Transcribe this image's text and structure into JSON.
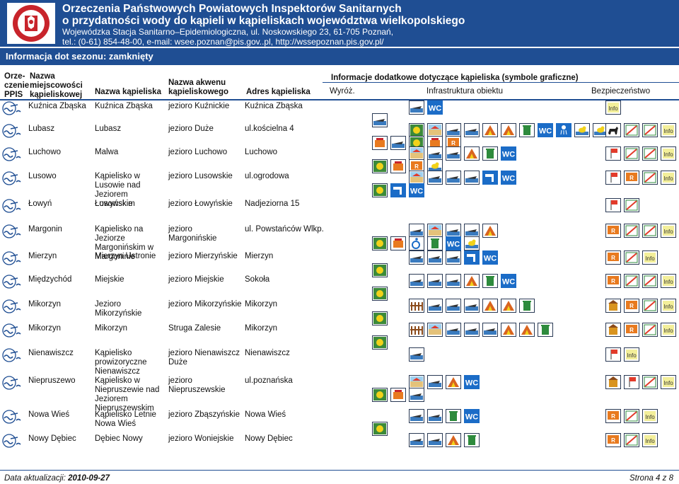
{
  "header": {
    "line1": "Orzeczenia Państwowych Powiatowych Inspektorów Sanitarnych",
    "line2": "o przydatności wody do kąpieli w kąpieliskach województwa wielkopolskiego",
    "line3": "Wojewódzka Stacja Sanitarno–Epidemiologiczna, ul. Noskowskiego 23, 61-705 Poznań,",
    "line4": "tel.: (0-61) 854-48-00, e-mail: wsee.poznan@pis.gov..pl, http://wssepoznan.pis.gov.pl/",
    "logo_text": "PAŃSTWOWA INSPEKCJA SANITARNA"
  },
  "season": "Informacja dot sezonu:   zamknięty",
  "columns": {
    "orzeczenie": "Orze-\nczenie\nPPIS",
    "miejscowosc": "Nazwa\nmiejscowości\nkąpieliskowej",
    "kapielisko": "Nazwa kąpieliska",
    "akwen": "Nazwa akwenu\nkąpieliskowego",
    "adres": "Adres kąpieliska",
    "info": "Informacje dodatkowe dotyczące kąpieliska (symbole graficzne)",
    "wyroz": "Wyróż.",
    "infra": "Infrastruktura obiektu",
    "bezp": "Bezpieczeństwo"
  },
  "rows": [
    {
      "miejscowosc": "Kuźnica Zbąska",
      "kapielisko": "Kuźnica Zbąska",
      "akwen": "jezioro Kuźnickie",
      "adres": "Kuźnica Zbąska",
      "infra": [
        "boat-icon",
        "wc-icon"
      ],
      "infra2": [
        "boat-icon"
      ],
      "bezp": [
        "info-icon"
      ]
    },
    {
      "miejscowosc": "Lubasz",
      "kapielisko": "Lubasz",
      "akwen": "jezioro Duże",
      "adres": "ul.kościelna 4",
      "infra": [
        "volleyball-icon",
        "beach-icon",
        "boat-icon",
        "kayak-icon",
        "tent-icon",
        "campfire-icon",
        "bin-icon",
        "wc-icon",
        "shower-icon",
        "playground-icon",
        "duck-icon"
      ],
      "infra2": [
        "grill-icon",
        "pier-icon",
        "sun-icon",
        "food-icon",
        "rescue-icon"
      ],
      "bezp": [
        "dog-icon",
        "no-smoking-icon",
        "no-alcohol-icon",
        "info-icon"
      ]
    },
    {
      "miejscowosc": "Luchowo",
      "kapielisko": "Malwa",
      "akwen": "jezioro Luchowo",
      "adres": "Luchowo",
      "infra": [
        "beach-icon",
        "boat-icon",
        "kayak-icon",
        "tent-icon",
        "bin-icon",
        "wc-icon"
      ],
      "infra2": [
        "sun-icon",
        "food-icon",
        "rescue-icon",
        "playground-icon"
      ],
      "bezp": [
        "flag-icon",
        "no-smoking-icon",
        "no-alcohol-icon",
        "info-icon"
      ]
    },
    {
      "miejscowosc": "Lusowo",
      "kapielisko": "Kąpielisko w Lusowie nad Jeziorem Lusowskim",
      "akwen": "jezioro Lusowskie",
      "adres": "ul.ogrodowa",
      "infra": [
        "beach-icon",
        "boat-icon",
        "kayak-icon",
        "pier-icon",
        "tap-icon",
        "wc-icon"
      ],
      "infra2": [
        "sun-icon",
        "tap-icon",
        "wc-icon"
      ],
      "bezp": [
        "flag-icon",
        "rescue-icon",
        "no-alcohol-icon",
        "info-icon"
      ]
    },
    {
      "miejscowosc": "Łowyń",
      "kapielisko": "Łowyńskie",
      "akwen": "jezioro Łowyńskie",
      "adres": "Nadjeziorna 15",
      "infra": [],
      "infra2": [],
      "bezp": [
        "flag-icon",
        "no-alcohol-icon"
      ]
    },
    {
      "miejscowosc": "Margonin",
      "kapielisko": "Kąpielisko na Jeziorze Margonińskim w Margoninie",
      "akwen": "jezioro Margonińskie",
      "adres": "ul. Powstańców Wlkp.",
      "infra": [
        "boat-icon",
        "beach-icon",
        "kayak-icon",
        "pier-icon",
        "tent-icon"
      ],
      "infra2": [
        "sun-icon",
        "food-icon",
        "disabled-icon",
        "bin-icon",
        "wc-icon",
        "duck-icon"
      ],
      "bezp": [
        "rescue-icon",
        "no-smoking-icon",
        "no-alcohol-icon",
        "info-icon"
      ]
    },
    {
      "miejscowosc": "Mierzyn",
      "kapielisko": "Mierzyn Ustronie",
      "akwen": "jezioro Mierzyńskie",
      "adres": "Mierzyn",
      "infra": [
        "boat-icon",
        "pier-icon",
        "kayak-icon",
        "tap-icon",
        "wc-icon"
      ],
      "infra2": [
        "sun-icon"
      ],
      "bezp": [
        "rescue-icon",
        "no-alcohol-icon",
        "info-icon"
      ]
    },
    {
      "miejscowosc": "Międzychód",
      "kapielisko": "Miejskie",
      "akwen": "jezioro Miejskie",
      "adres": "Sokoła",
      "infra": [
        "boat-icon",
        "kayak-icon",
        "pier-icon",
        "tent-icon",
        "bin-icon",
        "wc-icon"
      ],
      "infra2": [
        "sun-icon"
      ],
      "bezp": [
        "rescue-icon",
        "no-smoking-icon",
        "no-alcohol-icon",
        "info-icon"
      ]
    },
    {
      "miejscowosc": "Mikorzyn",
      "kapielisko": "Jezioro Mikorzyńskie",
      "akwen": "jezioro Mikorzyńskie",
      "adres": "Mikorzyn",
      "infra": [
        "fence-icon",
        "boat-icon",
        "kayak-icon",
        "pier-icon",
        "tent-icon",
        "campfire-icon",
        "bin-icon"
      ],
      "infra2": [
        "sun-icon"
      ],
      "bezp": [
        "cabin-icon",
        "rescue-icon",
        "no-alcohol-icon",
        "info-icon"
      ]
    },
    {
      "miejscowosc": "Mikorzyn",
      "kapielisko": "Mikorzyn",
      "akwen": "Struga Zalesie",
      "adres": "Mikorzyn",
      "infra": [
        "fence-icon",
        "beach-icon",
        "boat-icon",
        "kayak-icon",
        "pier-icon",
        "tent-icon",
        "campfire-icon",
        "bin-icon"
      ],
      "infra2": [
        "sun-icon"
      ],
      "bezp": [
        "cabin-icon",
        "rescue-icon",
        "no-alcohol-icon",
        "info-icon"
      ]
    },
    {
      "miejscowosc": "Nienawiszcz",
      "kapielisko": "Kąpielisko prowizoryczne Nienawiszcz",
      "akwen": "jezioro Nienawiszcz Duże",
      "adres": "Nienawiszcz",
      "infra": [
        "boat-icon"
      ],
      "infra2": [],
      "bezp": [
        "flag-icon",
        "info-icon"
      ]
    },
    {
      "miejscowosc": "Niepruszewo",
      "kapielisko": "Kąpielisko w Niepruszewie nad Jeziorem Niepruszewskim",
      "akwen": "jezioro Niepruszewskie",
      "adres": "ul.poznańska",
      "infra": [
        "beach-icon",
        "boat-icon",
        "tent-icon",
        "wc-icon"
      ],
      "infra2": [
        "sun-icon",
        "food-icon",
        "pier-icon"
      ],
      "bezp": [
        "cabin-icon",
        "flag-icon",
        "no-alcohol-icon",
        "info-icon"
      ]
    },
    {
      "miejscowosc": "Nowa Wieś",
      "kapielisko": "Kąpielisko Letnie Nowa Wieś",
      "akwen": "jezioro Zbąszyńskie",
      "adres": "Nowa Wieś",
      "infra": [
        "boat-icon",
        "kayak-icon",
        "bin-icon",
        "wc-icon"
      ],
      "infra2": [
        "sun-icon"
      ],
      "bezp": [
        "rescue-icon",
        "no-alcohol-icon",
        "info-icon"
      ]
    },
    {
      "miejscowosc": "Nowy Dębiec",
      "kapielisko": "Dębiec Nowy",
      "akwen": "jezioro Woniejskie",
      "adres": "Nowy Dębiec",
      "infra": [
        "boat-icon",
        "kayak-icon",
        "tent-icon",
        "bin-icon"
      ],
      "infra2": [],
      "bezp": [
        "rescue-icon",
        "no-alcohol-icon",
        "info-icon"
      ]
    }
  ],
  "footer": {
    "updated_label": "Data aktualizacji:",
    "updated_value": "2010-09-27",
    "page": "Strona 4 z 8"
  },
  "colors": {
    "brand": "#1f4e93",
    "wc": "#1b6cc7",
    "tap": "#1b6cc7",
    "bin": "#2e8b3d",
    "flag": "#e23b2b",
    "sun": "#f2d21a"
  }
}
